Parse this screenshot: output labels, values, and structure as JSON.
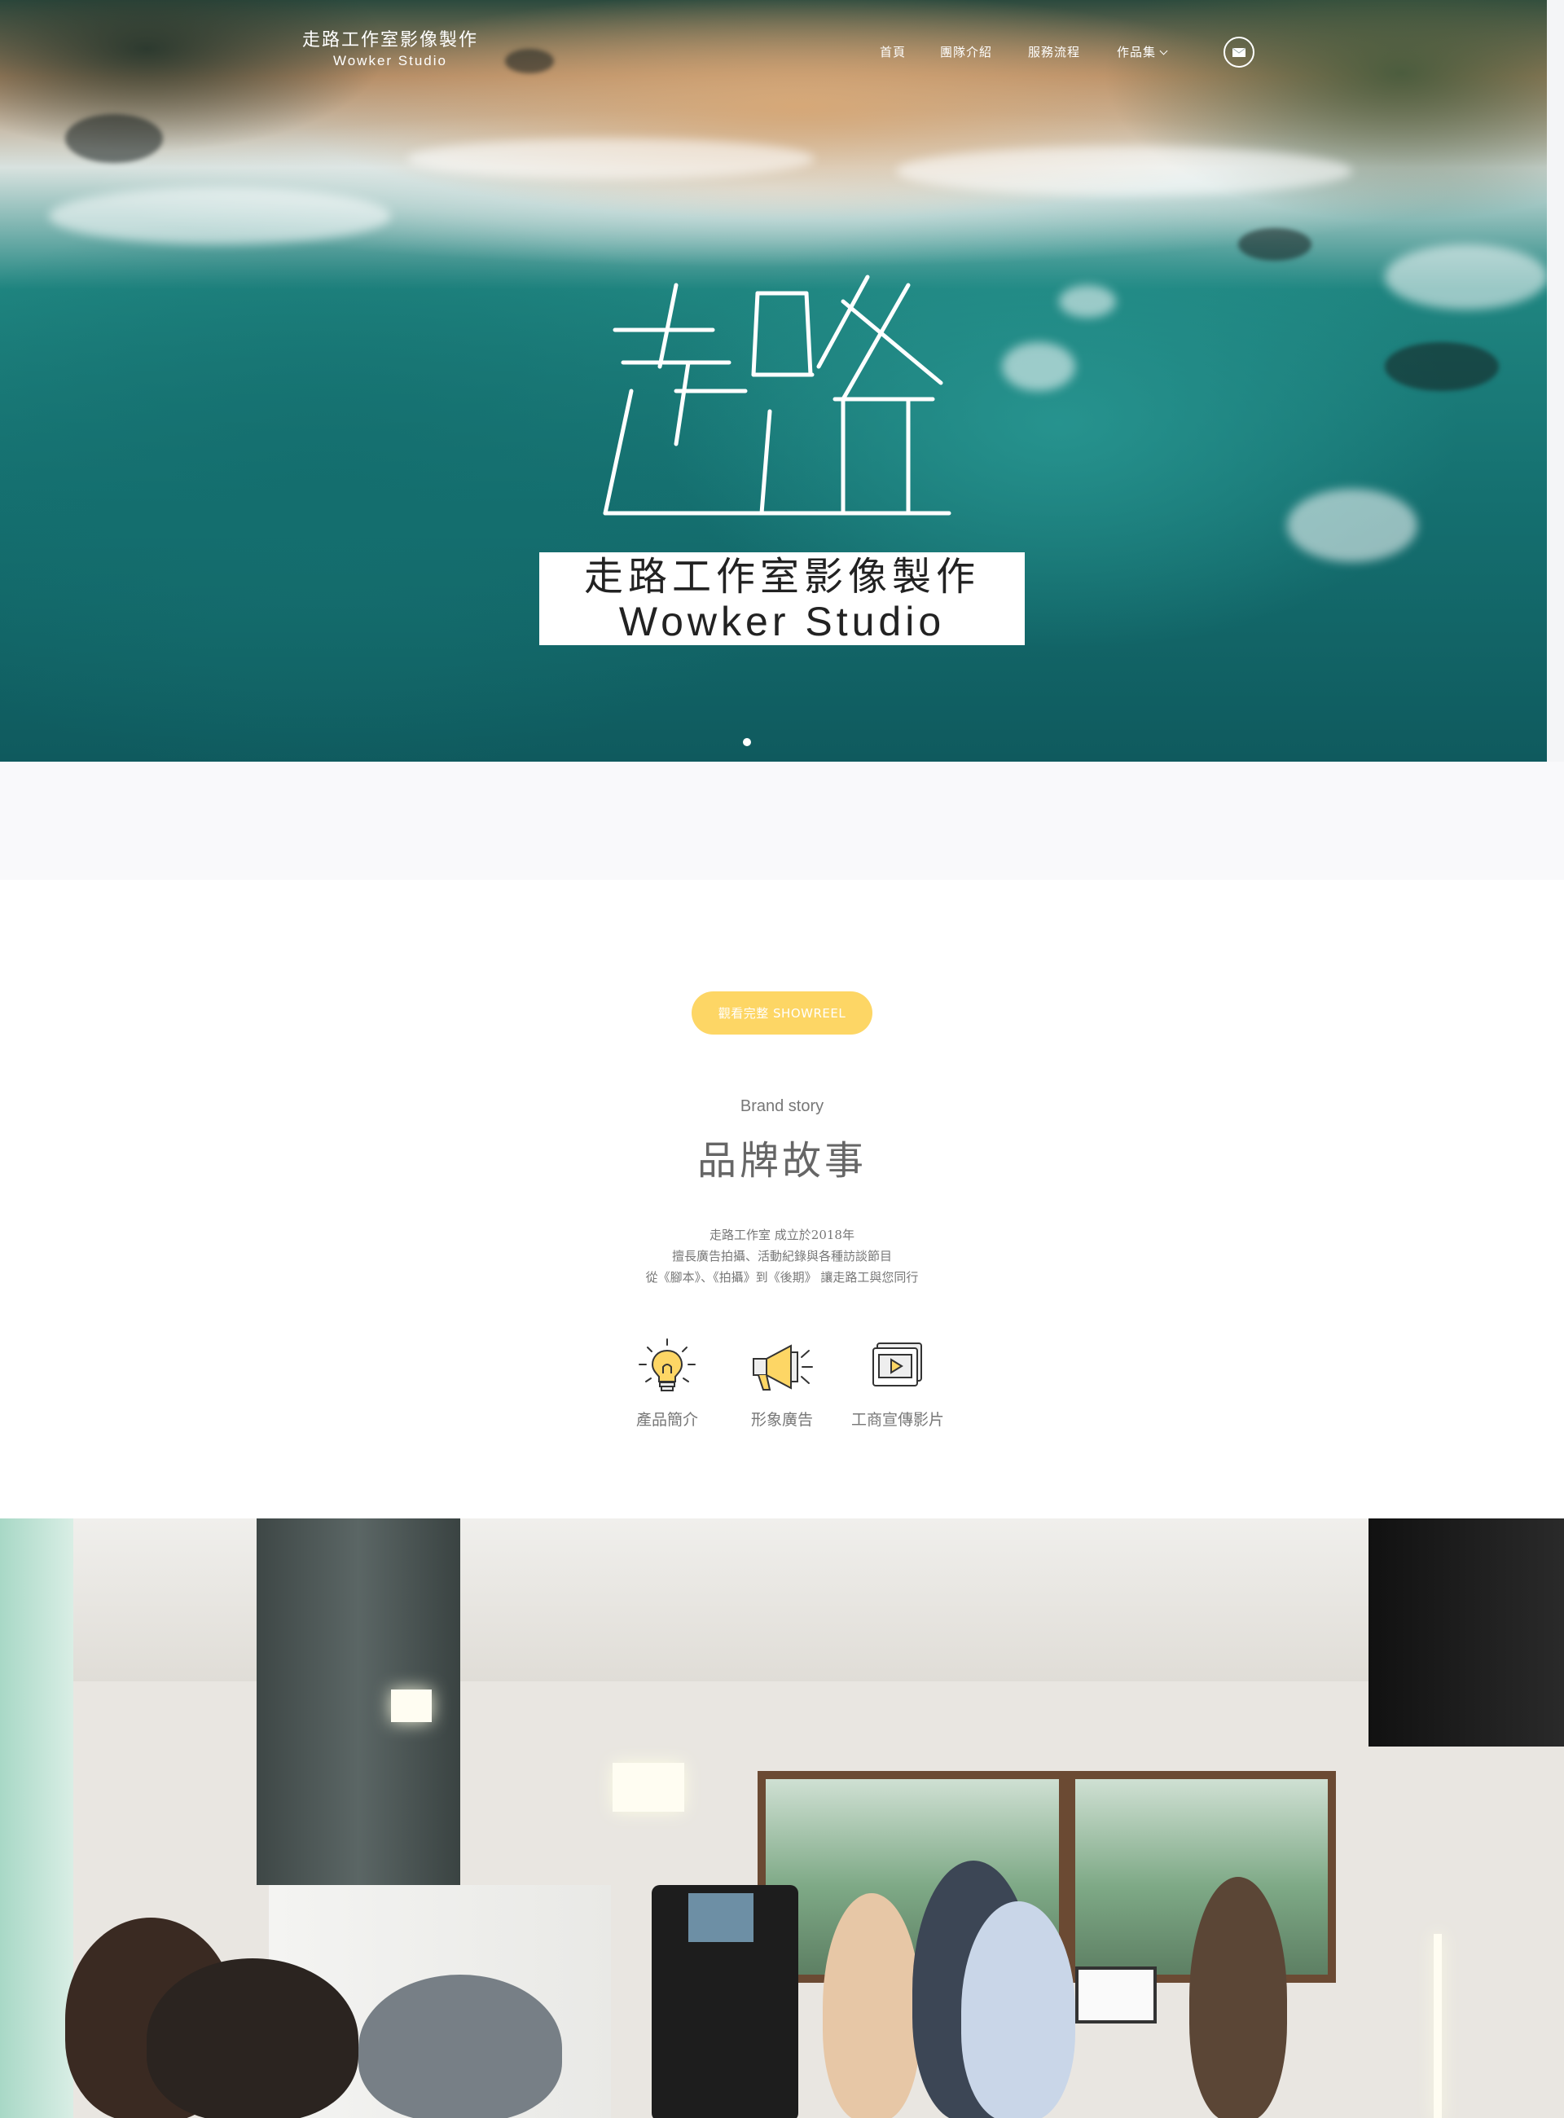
{
  "brand": {
    "name_zh": "走路工作室影像製作",
    "name_en": "Wowker Studio"
  },
  "nav": {
    "items": [
      {
        "label": "首頁"
      },
      {
        "label": "團隊介紹"
      },
      {
        "label": "服務流程"
      },
      {
        "label": "作品集"
      }
    ],
    "contact_icon": "mail-icon"
  },
  "hero": {
    "calligraphy": "走路",
    "title_zh": "走路工作室影像製作",
    "title_en": "Wowker Studio"
  },
  "brand_story": {
    "showreel_button": "觀看完整 SHOWREEL",
    "subtitle": "Brand story",
    "title": "品牌故事",
    "lines": [
      "走路工作室 成立於2018年",
      "擅長廣告拍攝、活動紀錄與各種訪談節目",
      "從《腳本》、《拍攝》到《後期》 讓走路工與您同行"
    ],
    "features": [
      {
        "label": "產品簡介",
        "icon": "lightbulb-icon"
      },
      {
        "label": "形象廣告",
        "icon": "megaphone-icon"
      },
      {
        "label": "工商宣傳影片",
        "icon": "video-player-icon"
      }
    ]
  },
  "colors": {
    "accent_yellow": "#fdd665",
    "hero_sea": "#157070"
  }
}
